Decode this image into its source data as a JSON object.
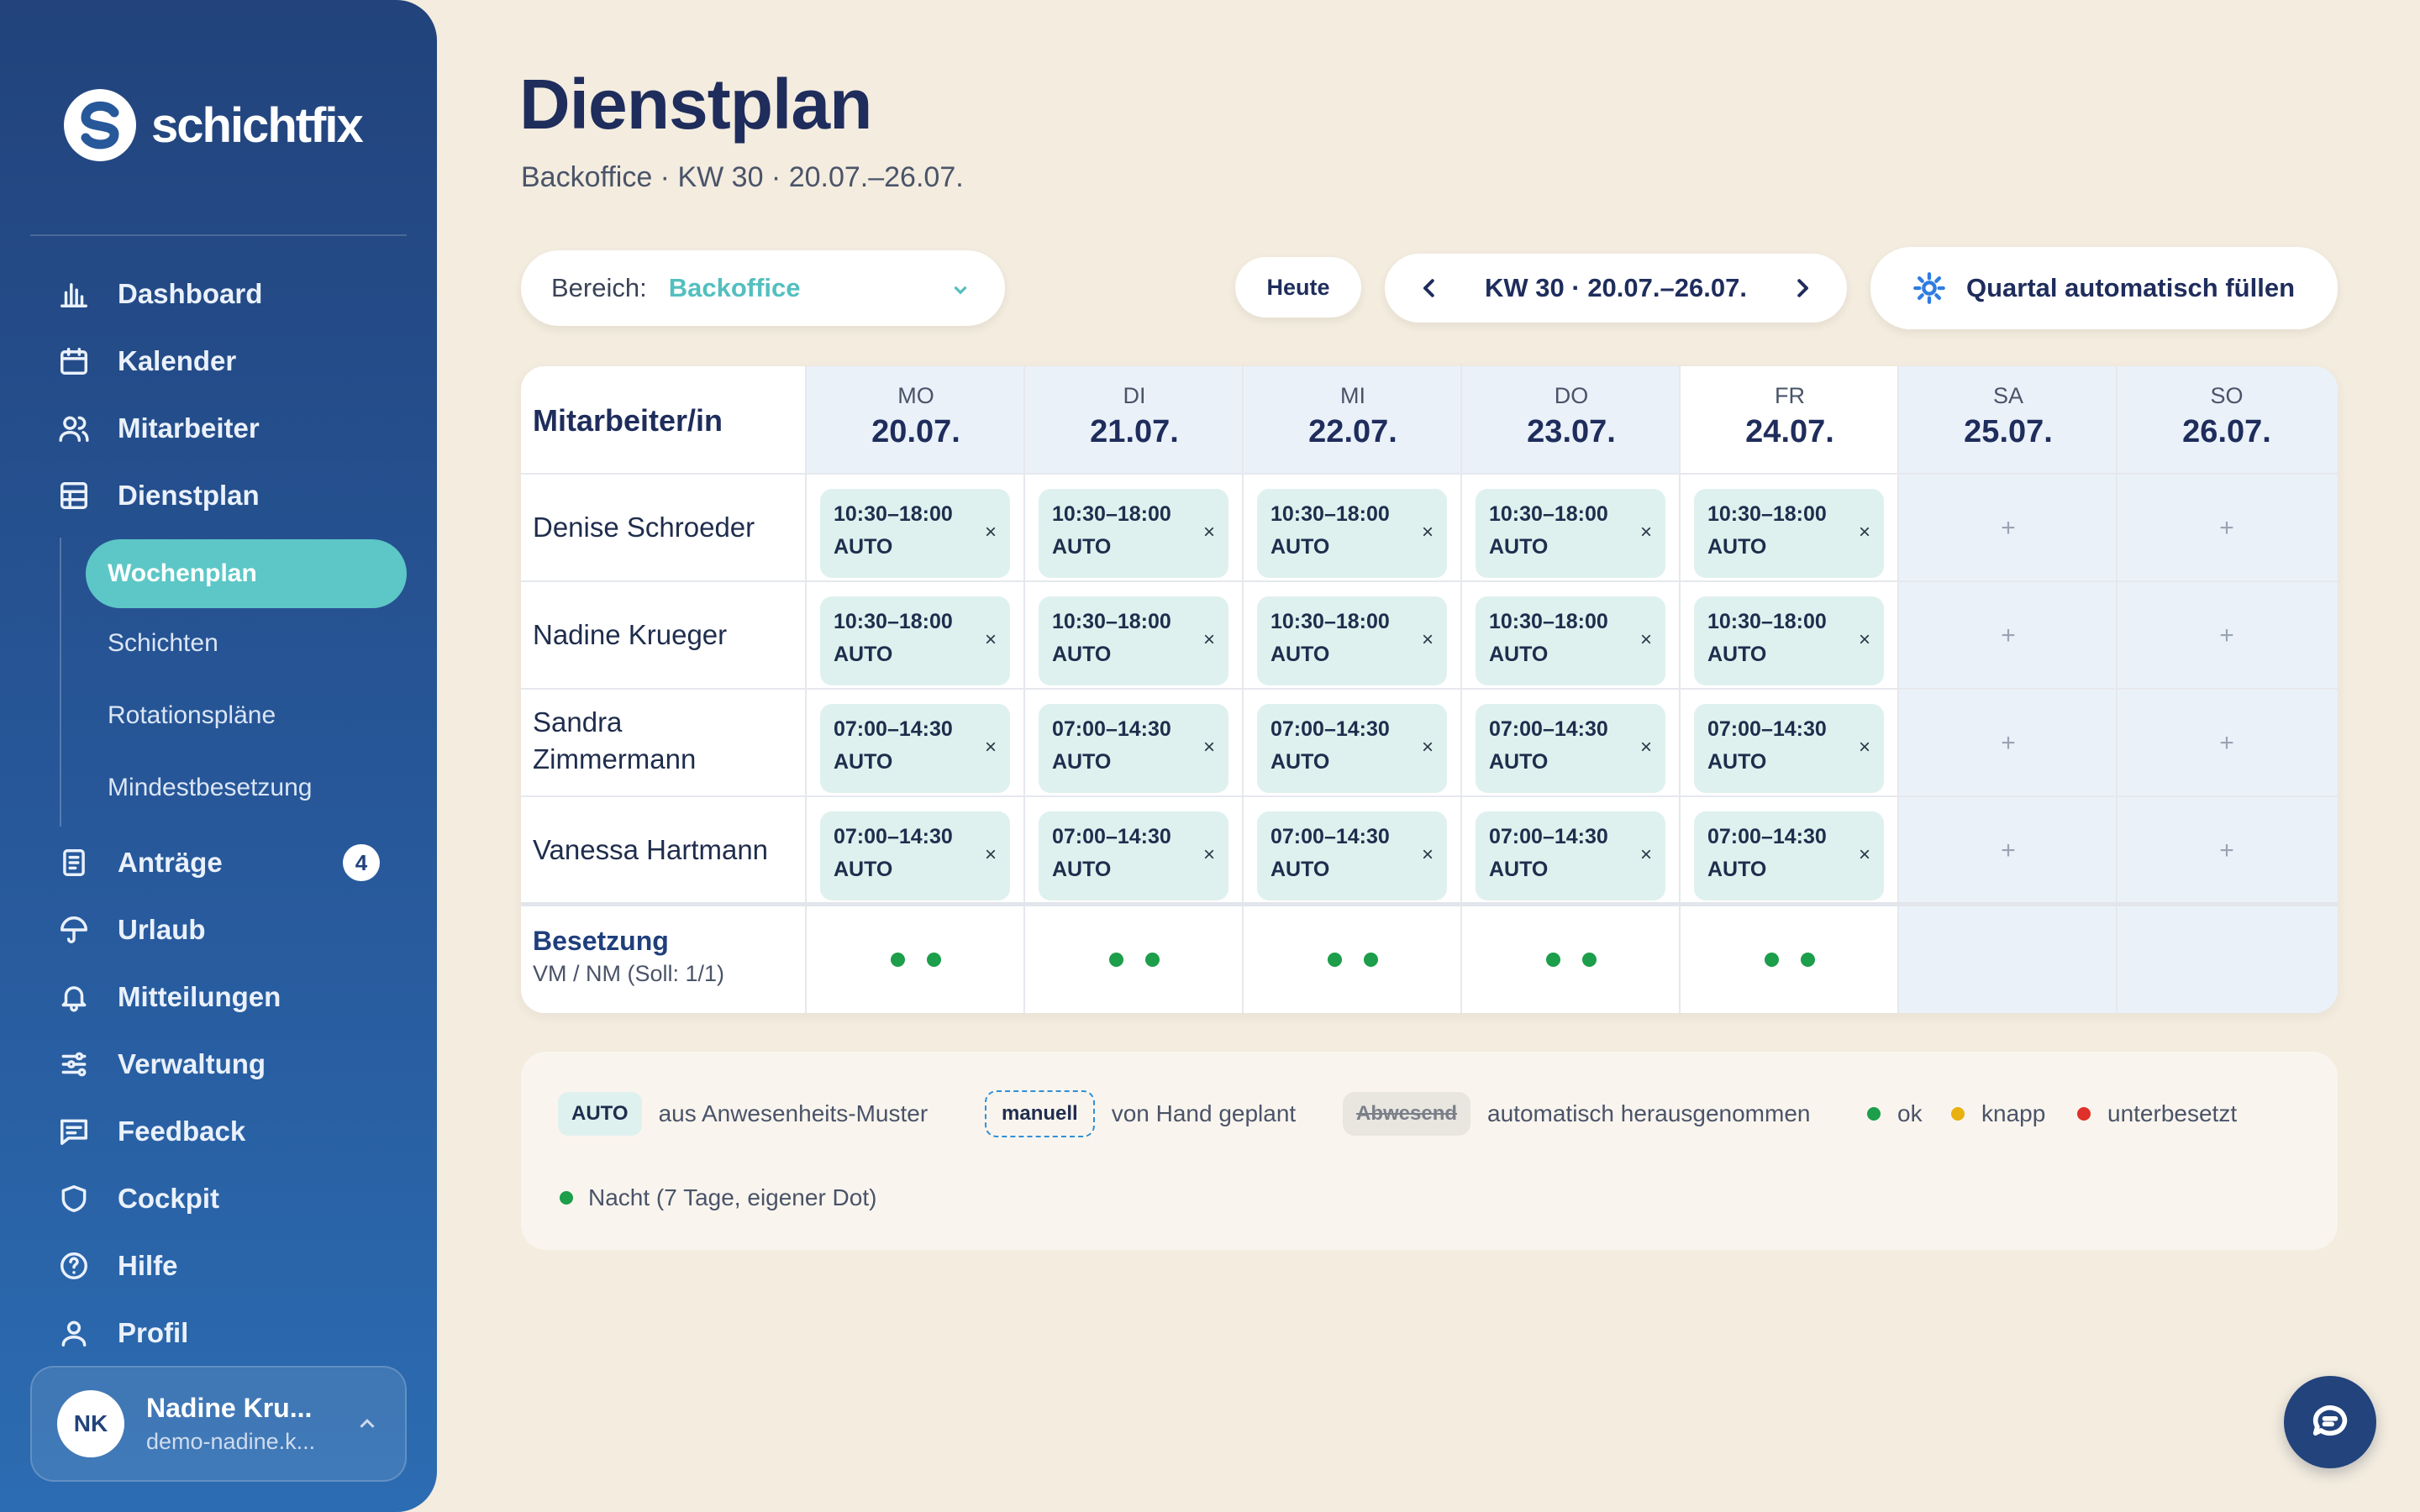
{
  "app": {
    "name": "schichtfix"
  },
  "nav": {
    "items": [
      {
        "label": "Dashboard",
        "icon": "bar-chart-icon"
      },
      {
        "label": "Kalender",
        "icon": "calendar-icon"
      },
      {
        "label": "Mitarbeiter",
        "icon": "users-icon"
      },
      {
        "label": "Dienstplan",
        "icon": "table-grid-icon"
      },
      {
        "label": "Anträge",
        "icon": "document-icon",
        "badge": "4"
      },
      {
        "label": "Urlaub",
        "icon": "umbrella-icon"
      },
      {
        "label": "Mitteilungen",
        "icon": "bell-icon"
      },
      {
        "label": "Verwaltung",
        "icon": "sliders-icon"
      },
      {
        "label": "Feedback",
        "icon": "message-icon"
      },
      {
        "label": "Cockpit",
        "icon": "shield-icon"
      },
      {
        "label": "Hilfe",
        "icon": "help-circle-icon"
      },
      {
        "label": "Profil",
        "icon": "user-icon"
      }
    ],
    "sub_items": [
      {
        "label": "Wochenplan",
        "active": true
      },
      {
        "label": "Schichten"
      },
      {
        "label": "Rotationspläne"
      },
      {
        "label": "Mindestbesetzung"
      }
    ]
  },
  "user": {
    "initials": "NK",
    "name": "Nadine Kru...",
    "email": "demo-nadine.k..."
  },
  "page": {
    "title": "Dienstplan",
    "subtitle": "Backoffice · KW 30 · 20.07.–26.07."
  },
  "toolbar": {
    "area_label": "Bereich:",
    "area_value": "Backoffice",
    "today_label": "Heute",
    "week_label": "KW 30 · 20.07.–26.07.",
    "fill_label": "Quartal automatisch füllen"
  },
  "table": {
    "employee_header": "Mitarbeiter/in",
    "days": [
      {
        "name": "MO",
        "date": "20.07."
      },
      {
        "name": "DI",
        "date": "21.07."
      },
      {
        "name": "MI",
        "date": "22.07."
      },
      {
        "name": "DO",
        "date": "23.07."
      },
      {
        "name": "FR",
        "date": "24.07."
      },
      {
        "name": "SA",
        "date": "25.07."
      },
      {
        "name": "SO",
        "date": "26.07."
      }
    ],
    "rows": [
      {
        "name": "Denise Schroeder",
        "time": "10:30–18:00",
        "tag": "AUTO",
        "remove": "×"
      },
      {
        "name": "Nadine Krueger",
        "time": "10:30–18:00",
        "tag": "AUTO",
        "remove": "×"
      },
      {
        "name": "Sandra Zimmermann",
        "time": "07:00–14:30",
        "tag": "AUTO",
        "remove": "×"
      },
      {
        "name": "Vanessa Hartmann",
        "time": "07:00–14:30",
        "tag": "AUTO",
        "remove": "×"
      }
    ],
    "add_symbol": "+",
    "coverage_title": "Besetzung",
    "coverage_sub": "VM / NM (Soll: 1/1)",
    "coverage_color": "#1c9e4a"
  },
  "legend": {
    "auto_tag": "AUTO",
    "auto_text": "aus Anwesenheits-Muster",
    "manual_tag": "manuell",
    "manual_text": "von Hand geplant",
    "absent_tag": "Abwesend",
    "absent_text": "automatisch herausgenommen",
    "ok": "ok",
    "tight": "knapp",
    "under": "unterbesetzt",
    "night": "Nacht (7 Tage, eigener Dot)",
    "colors": {
      "ok": "#1c9e4a",
      "tight": "#e8b010",
      "under": "#e0302a",
      "night": "#1c9e4a"
    }
  },
  "colors": {
    "accent": "#5cc7c6",
    "navy": "#22437c",
    "background": "#f3ecdf"
  }
}
